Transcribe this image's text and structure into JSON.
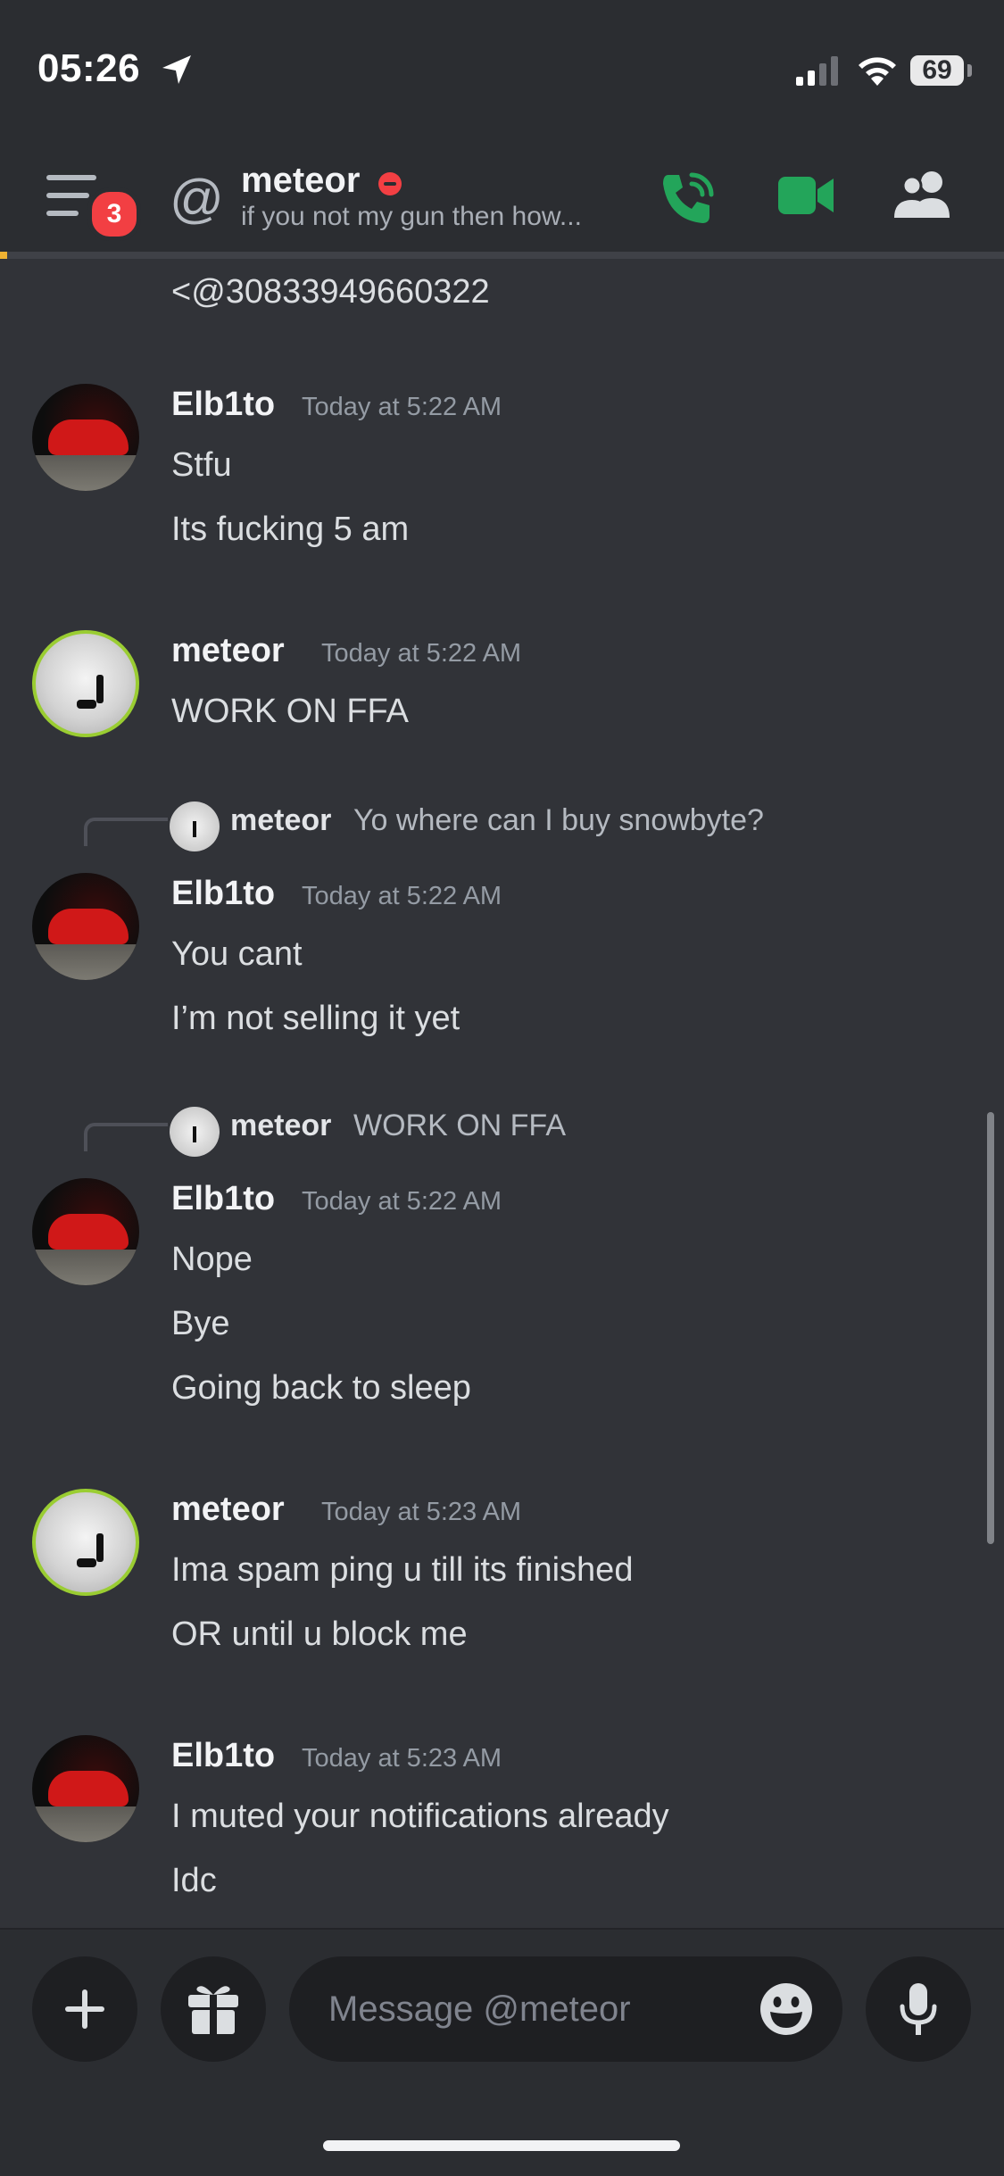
{
  "status_bar": {
    "time": "05:26",
    "battery": "69"
  },
  "header": {
    "badge_count": "3",
    "name": "meteor",
    "status_text": "if you not my gun then how..."
  },
  "messages": {
    "cut_off_line": "<@30833949660322",
    "m1": {
      "author": "Elb1to",
      "time": "Today at 5:22 AM",
      "lines": [
        "Stfu",
        "Its fucking 5 am"
      ]
    },
    "m2": {
      "author": "meteor",
      "time": "Today at 5:22 AM",
      "lines": [
        "WORK ON FFA"
      ]
    },
    "m3": {
      "reply": {
        "author": "meteor",
        "text": "Yo where can I buy snowbyte?"
      },
      "author": "Elb1to",
      "time": "Today at 5:22 AM",
      "lines": [
        "You cant",
        "I’m not selling it yet"
      ]
    },
    "m4": {
      "reply": {
        "author": "meteor",
        "text": "WORK ON FFA"
      },
      "author": "Elb1to",
      "time": "Today at 5:22 AM",
      "lines": [
        "Nope",
        "Bye",
        "Going back to sleep"
      ]
    },
    "m5": {
      "author": "meteor",
      "time": "Today at 5:23 AM",
      "lines": [
        "Ima spam ping u till its finished",
        "OR until u block me"
      ]
    },
    "m6": {
      "author": "Elb1to",
      "time": "Today at 5:23 AM",
      "lines": [
        "I muted your notifications already",
        "Idc"
      ]
    }
  },
  "composer": {
    "placeholder": "Message @meteor"
  },
  "colors": {
    "accent_green": "#23a55a",
    "dnd_red": "#f23f43",
    "background": "#313338"
  }
}
